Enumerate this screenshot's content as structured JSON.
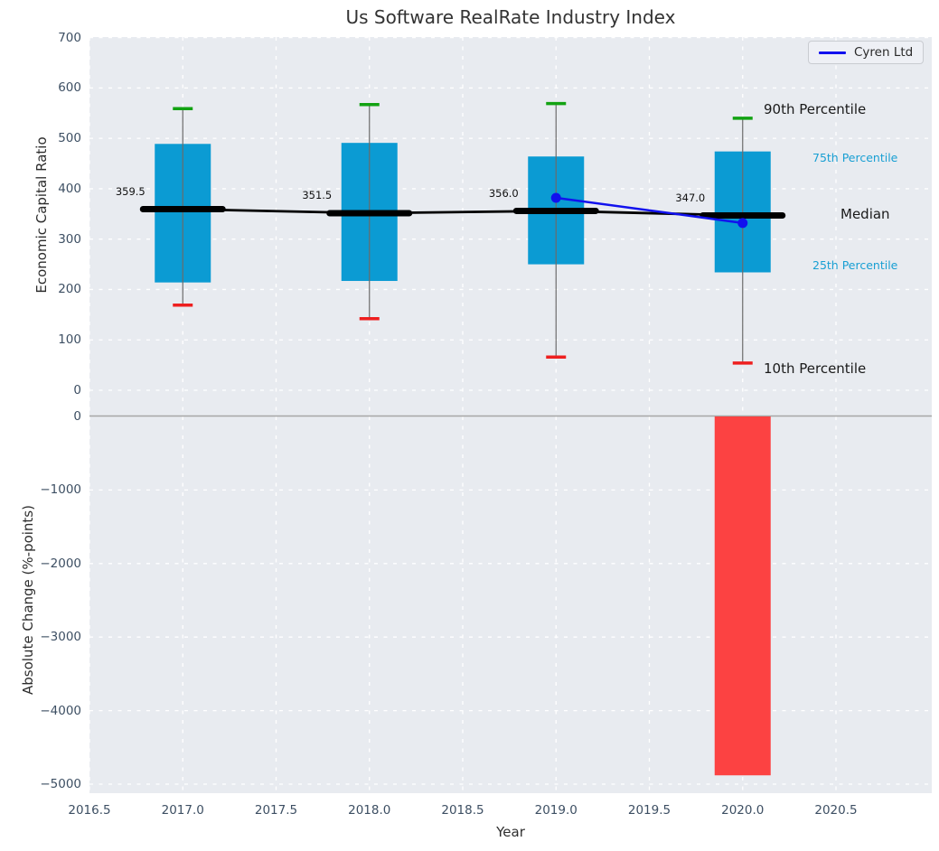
{
  "chart_data": [
    {
      "type": "boxplot",
      "panel": "top",
      "title": "Us Software RealRate Industry Index",
      "ylabel": "Economic Capital Ratio",
      "ylim": [
        -30,
        705
      ],
      "yticks": [
        0,
        100,
        200,
        300,
        400,
        500,
        600,
        700
      ],
      "grid": true,
      "legend_position": "top-right",
      "boxes": [
        {
          "year": 2017,
          "p10": 169,
          "p25": 214,
          "median": 359.5,
          "p75": 489,
          "p90": 559,
          "label": "359.5"
        },
        {
          "year": 2018,
          "p10": 142,
          "p25": 217,
          "median": 351.5,
          "p75": 491,
          "p90": 567,
          "label": "351.5"
        },
        {
          "year": 2019,
          "p10": 66,
          "p25": 250,
          "median": 356.0,
          "p75": 464,
          "p90": 569,
          "label": "356.0"
        },
        {
          "year": 2020,
          "p10": 54,
          "p25": 234,
          "median": 347.0,
          "p75": 474,
          "p90": 540,
          "label": "347.0"
        }
      ],
      "median_line": {
        "x": [
          2017,
          2018,
          2019,
          2020
        ],
        "y": [
          359.5,
          351.5,
          356.0,
          347.0
        ]
      },
      "series": [
        {
          "name": "Cyren Ltd",
          "type": "line",
          "x": [
            2019,
            2020
          ],
          "y": [
            382,
            332
          ]
        }
      ],
      "annotations": [
        {
          "text": "90th Percentile",
          "style": "big"
        },
        {
          "text": "75th Percentile",
          "style": "small"
        },
        {
          "text": "Median",
          "style": "big"
        },
        {
          "text": "25th Percentile",
          "style": "small"
        },
        {
          "text": "10th Percentile",
          "style": "big"
        }
      ]
    },
    {
      "type": "bar",
      "panel": "bottom",
      "ylabel": "Absolute Change (%-points)",
      "xlabel": "Year",
      "ylim": [
        -5150,
        170
      ],
      "yticks": [
        0,
        -1000,
        -2000,
        -3000,
        -4000,
        -5000
      ],
      "ytick_labels": [
        "0",
        "−1000",
        "−2000",
        "−3000",
        "−4000",
        "−5000"
      ],
      "xticks": [
        2016.5,
        2017.0,
        2017.5,
        2018.0,
        2018.5,
        2019.0,
        2019.5,
        2020.0,
        2020.5
      ],
      "xtick_labels": [
        "2016.5",
        "2017.0",
        "2017.5",
        "2018.0",
        "2018.5",
        "2019.0",
        "2019.5",
        "2020.0",
        "2020.5"
      ],
      "grid": true,
      "bars": [
        {
          "year": 2020,
          "value": -4880
        }
      ]
    }
  ],
  "colors": {
    "axes_background": "#e8ebf0",
    "gridline": "#ffffff",
    "box_fill": "#0b9bd3",
    "whisker": "#6b6b6b",
    "cap_top_90th": "#12a212",
    "cap_bottom_10th": "#ee1f1f",
    "median": "#000000",
    "cyren_line": "#1111ee",
    "bar_negative": "#fc4242",
    "zero_line": "#a6a6a6",
    "tick_text": "#3d4f63",
    "percentile_text": "#189fd3"
  }
}
